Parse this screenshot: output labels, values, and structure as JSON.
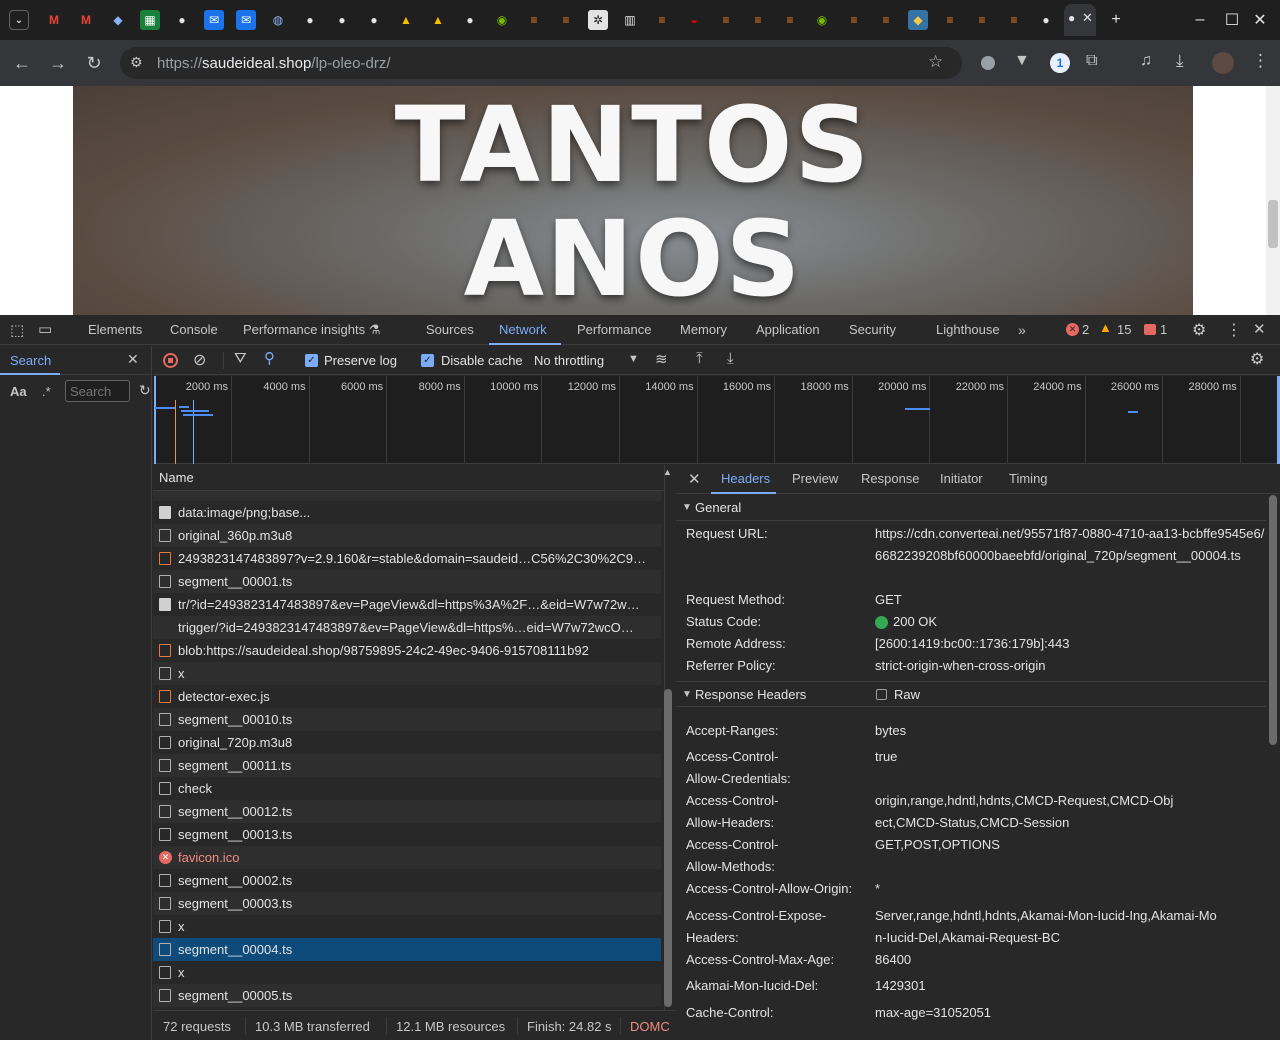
{
  "browser": {
    "url_scheme": "https://",
    "url_host": "saudeideal.shop",
    "url_path": "/lp-oleo-drz/",
    "tab_icons": [
      "gmail-icon",
      "gmail-icon",
      "cloud-icon",
      "sheets-icon",
      "github-icon",
      "chat-icon",
      "chat-icon",
      "database-icon",
      "github-icon",
      "github-icon",
      "github-icon",
      "drive-icon",
      "drive-icon",
      "github-icon",
      "nvidia-icon",
      "stackoverflow-icon",
      "stackoverflow-icon",
      "openai-icon",
      "book-icon",
      "stackoverflow-icon",
      "redhat-icon",
      "stackoverflow-icon",
      "stackoverflow-icon",
      "stackoverflow-icon",
      "nvidia-icon",
      "stackoverflow-icon",
      "stackoverflow-icon",
      "python-icon",
      "stackoverflow-icon",
      "stackoverflow-icon",
      "stackoverflow-icon",
      "github-icon"
    ]
  },
  "page": {
    "line1": "TANTOS",
    "line2": "ANOS"
  },
  "devtools": {
    "tabs": [
      "Elements",
      "Console",
      "Performance insights",
      "Sources",
      "Network",
      "Performance",
      "Memory",
      "Application",
      "Security",
      "Lighthouse"
    ],
    "active_tab": "Network",
    "errors": "2",
    "warnings": "15",
    "issues": "1",
    "search": {
      "title": "Search",
      "aa": "Aa",
      "regex": ".*",
      "placeholder": "Search"
    },
    "network": {
      "preserve_log": "Preserve log",
      "disable_cache": "Disable cache",
      "throttling": "No throttling",
      "ticks": [
        "2000 ms",
        "4000 ms",
        "6000 ms",
        "8000 ms",
        "10000 ms",
        "12000 ms",
        "14000 ms",
        "16000 ms",
        "18000 ms",
        "20000 ms",
        "22000 ms",
        "24000 ms",
        "26000 ms",
        "28000 ms"
      ],
      "name_header": "Name",
      "requests": [
        {
          "name": "data:image/png;base...",
          "icon": "img",
          "status": "ok"
        },
        {
          "name": "original_360p.m3u8",
          "icon": "doc",
          "status": "ok"
        },
        {
          "name": "2493823147483897?v=2.9.160&r=stable&domain=saudeid…C56%2C30%2C9…",
          "icon": "script",
          "status": "ok"
        },
        {
          "name": "segment__00001.ts",
          "icon": "doc",
          "status": "ok"
        },
        {
          "name": "tr/?id=2493823147483897&ev=PageView&dl=https%3A%2F…&eid=W7w72w…",
          "icon": "img",
          "status": "ok"
        },
        {
          "name": "trigger/?id=2493823147483897&ev=PageView&dl=https%…eid=W7w72wcO…",
          "icon": "none",
          "status": "ok"
        },
        {
          "name": "blob:https://saudeideal.shop/98759895-24c2-49ec-9406-915708111b92",
          "icon": "script",
          "status": "ok"
        },
        {
          "name": "x",
          "icon": "doc",
          "status": "ok"
        },
        {
          "name": "detector-exec.js",
          "icon": "script",
          "status": "ok"
        },
        {
          "name": "segment__00010.ts",
          "icon": "doc",
          "status": "ok"
        },
        {
          "name": "original_720p.m3u8",
          "icon": "doc",
          "status": "ok"
        },
        {
          "name": "segment__00011.ts",
          "icon": "doc",
          "status": "ok"
        },
        {
          "name": "check",
          "icon": "doc",
          "status": "ok"
        },
        {
          "name": "segment__00012.ts",
          "icon": "doc",
          "status": "ok"
        },
        {
          "name": "segment__00013.ts",
          "icon": "doc",
          "status": "ok"
        },
        {
          "name": "favicon.ico",
          "icon": "err",
          "status": "error"
        },
        {
          "name": "segment__00002.ts",
          "icon": "doc",
          "status": "ok"
        },
        {
          "name": "segment__00003.ts",
          "icon": "doc",
          "status": "ok"
        },
        {
          "name": "x",
          "icon": "doc",
          "status": "ok"
        },
        {
          "name": "segment__00004.ts",
          "icon": "doc",
          "status": "selected"
        },
        {
          "name": "x",
          "icon": "doc",
          "status": "ok"
        },
        {
          "name": "segment__00005.ts",
          "icon": "doc",
          "status": "ok"
        }
      ],
      "status": {
        "requests": "72 requests",
        "transferred": "10.3 MB transferred",
        "resources": "12.1 MB resources",
        "finish": "Finish: 24.82 s",
        "domc": "DOMC"
      }
    },
    "details": {
      "tabs": [
        "Headers",
        "Preview",
        "Response",
        "Initiator",
        "Timing"
      ],
      "active_tab": "Headers",
      "general_title": "General",
      "general": [
        {
          "k": "Request URL:",
          "v": "https://cdn.converteai.net/95571f87-0880-4710-aa13-bcbffe9545e6/6682239208bf60000baeebfd/original_720p/segment__00004.ts"
        },
        {
          "k": "Request Method:",
          "v": "GET"
        },
        {
          "k": "Status Code:",
          "v": "200 OK"
        },
        {
          "k": "Remote Address:",
          "v": "[2600:1419:bc00::1736:179b]:443"
        },
        {
          "k": "Referrer Policy:",
          "v": "strict-origin-when-cross-origin"
        }
      ],
      "response_title": "Response Headers",
      "raw_label": "Raw",
      "response": [
        {
          "k": "Accept-Ranges:",
          "v": "bytes"
        },
        {
          "k": "Access-Control-Allow-Credentials:",
          "v": "true"
        },
        {
          "k": "Access-Control-Allow-Headers:",
          "v": "origin,range,hdntl,hdnts,CMCD-Request,CMCD-Object,CMCD-Status,CMCD-Session"
        },
        {
          "k": "Access-Control-Allow-Methods:",
          "v": "GET,POST,OPTIONS"
        },
        {
          "k": "Access-Control-Allow-Origin:",
          "v": "*"
        },
        {
          "k": "Access-Control-Expose-Headers:",
          "v": "Server,range,hdntl,hdnts,Akamai-Mon-Iucid-Ing,Akamai-Mon-Iucid-Del,Akamai-Request-BC"
        },
        {
          "k": "Access-Control-Max-Age:",
          "v": "86400"
        },
        {
          "k": "Akamai-Mon-Iucid-Del:",
          "v": "1429301"
        },
        {
          "k": "Cache-Control:",
          "v": "max-age=31052051"
        }
      ]
    }
  },
  "colors": {
    "accent": "#7cacf8",
    "selected_row": "#0e4a7a",
    "error": "#e46962",
    "status_ok": "#34a853"
  }
}
